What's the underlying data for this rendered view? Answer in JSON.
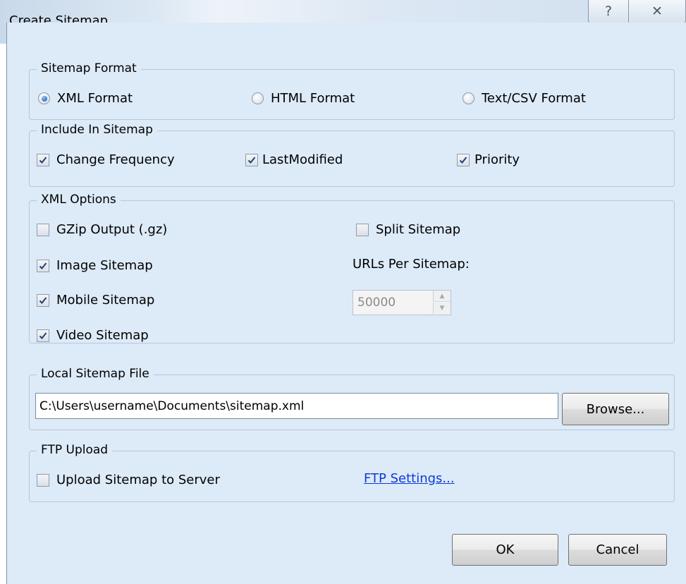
{
  "window": {
    "title": "Create Sitemap",
    "help_symbol": "?",
    "close_symbol": "✕"
  },
  "sitemap_format": {
    "legend": "Sitemap Format",
    "options": [
      {
        "label": "XML Format",
        "selected": true
      },
      {
        "label": "HTML Format",
        "selected": false
      },
      {
        "label": "Text/CSV Format",
        "selected": false
      }
    ]
  },
  "include": {
    "legend": "Include In Sitemap",
    "change_frequency": {
      "label": "Change Frequency",
      "checked": true
    },
    "last_modified": {
      "label": "LastModified",
      "checked": true
    },
    "priority": {
      "label": "Priority",
      "checked": true
    }
  },
  "xml_options": {
    "legend": "XML Options",
    "gzip": {
      "label": "GZip Output (.gz)",
      "checked": false
    },
    "image": {
      "label": "Image Sitemap",
      "checked": true
    },
    "mobile": {
      "label": "Mobile Sitemap",
      "checked": true
    },
    "video": {
      "label": "Video Sitemap",
      "checked": true
    },
    "split": {
      "label": "Split Sitemap",
      "checked": false
    },
    "urls_label": "URLs Per Sitemap:",
    "urls_value": "50000"
  },
  "local_file": {
    "legend": "Local Sitemap File",
    "path": "C:\\Users\\username\\Documents\\sitemap.xml",
    "browse_label": "Browse..."
  },
  "ftp": {
    "legend": "FTP Upload",
    "upload": {
      "label": "Upload Sitemap to Server",
      "checked": false
    },
    "settings_link": "FTP Settings..."
  },
  "buttons": {
    "ok": "OK",
    "cancel": "Cancel"
  },
  "colors": {
    "dialog_bg": "#ddeaf8",
    "group_border": "#b6c7da",
    "link": "#0c3bd7",
    "radio_dot": "#1753b4"
  }
}
